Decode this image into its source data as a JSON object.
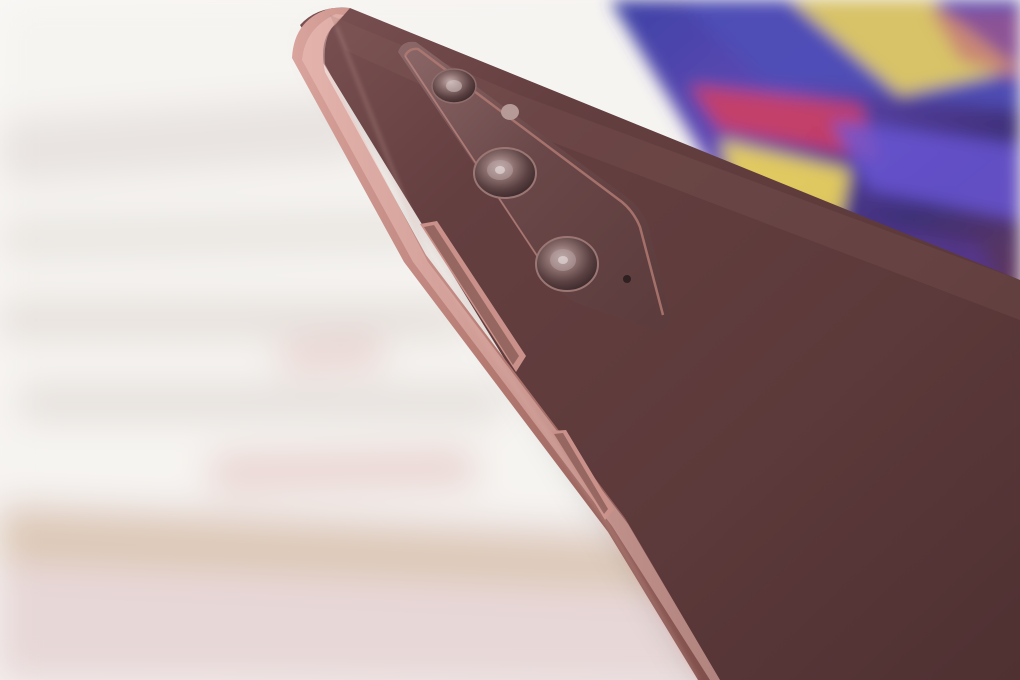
{
  "scene": {
    "subject": "smartphone-rear-side",
    "background": "blurred-open-book-and-colorful-cover",
    "colors": {
      "phone_body": "#5e3a3b",
      "phone_frame": "#b07a72",
      "page_paper": "#f2efec",
      "surface": "#e9dcdc",
      "cover_blue": "#4f4fb7",
      "cover_red": "#d53e5e",
      "cover_yellow": "#f0d85a"
    }
  }
}
